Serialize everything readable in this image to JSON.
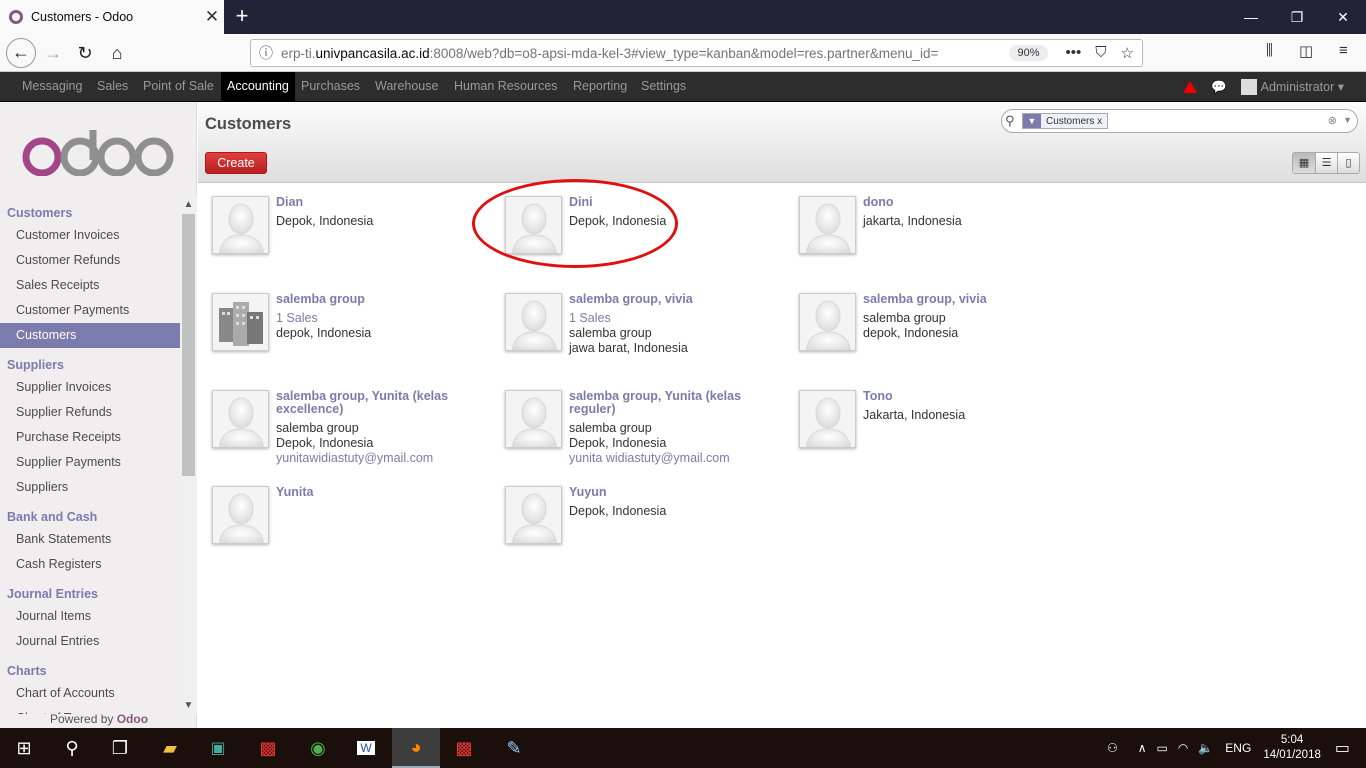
{
  "browser": {
    "tab_title": "Customers - Odoo",
    "url_prefix": "erp-ti.",
    "url_domain": "univpancasila.ac.id",
    "url_rest": ":8008/web?db=o8-apsi-mda-kel-3#view_type=kanban&model=res.partner&menu_id=",
    "zoom": "90%"
  },
  "topmenu": {
    "items": [
      "Messaging",
      "Sales",
      "Point of Sale",
      "Accounting",
      "Purchases",
      "Warehouse",
      "Human Resources",
      "Reporting",
      "Settings"
    ],
    "active": "Accounting",
    "user": "Administrator"
  },
  "sidebar": {
    "logo": "odoo",
    "sections": [
      {
        "title": "Customers",
        "items": [
          "Customer Invoices",
          "Customer Refunds",
          "Sales Receipts",
          "Customer Payments",
          "Customers"
        ]
      },
      {
        "title": "Suppliers",
        "items": [
          "Supplier Invoices",
          "Supplier Refunds",
          "Purchase Receipts",
          "Supplier Payments",
          "Suppliers"
        ]
      },
      {
        "title": "Bank and Cash",
        "items": [
          "Bank Statements",
          "Cash Registers"
        ]
      },
      {
        "title": "Journal Entries",
        "items": [
          "Journal Items",
          "Journal Entries"
        ]
      },
      {
        "title": "Charts",
        "items": [
          "Chart of Accounts",
          "Chart of Taxes"
        ]
      }
    ],
    "active_item": "Customers",
    "powered_by": "Powered by",
    "powered_brand": "Odoo"
  },
  "header": {
    "title": "Customers",
    "create_label": "Create",
    "search_facet": "Customers",
    "facet_close": "x"
  },
  "kanban": [
    {
      "name": "Dian",
      "lines": [
        "Depok, Indonesia"
      ],
      "email": "",
      "company": false
    },
    {
      "name": "Dini",
      "lines": [
        "Depok, Indonesia"
      ],
      "email": "",
      "company": false
    },
    {
      "name": "dono",
      "lines": [
        "jakarta, Indonesia"
      ],
      "email": "",
      "company": false
    },
    {
      "name": "salemba group",
      "sales": "1 Sales",
      "lines": [
        "depok, Indonesia"
      ],
      "email": "",
      "company": true
    },
    {
      "name": "salemba group, vivia",
      "sales": "1 Sales",
      "lines": [
        "salemba group",
        "jawa barat, Indonesia"
      ],
      "email": "",
      "company": false
    },
    {
      "name": "salemba group, vivia",
      "lines": [
        "salemba group",
        "depok, Indonesia"
      ],
      "email": "",
      "company": false
    },
    {
      "name": "salemba group, Yunita (kelas excellence)",
      "lines": [
        "salemba group",
        "Depok, Indonesia"
      ],
      "email": "yunitawidiastuty@ymail.com",
      "company": false
    },
    {
      "name": "salemba group, Yunita (kelas reguler)",
      "lines": [
        "salemba group",
        "Depok, Indonesia"
      ],
      "email": "yunita widiastuty@ymail.com",
      "company": false
    },
    {
      "name": "Tono",
      "lines": [
        "Jakarta, Indonesia"
      ],
      "email": "",
      "company": false
    },
    {
      "name": "Yunita",
      "lines": [],
      "email": "",
      "company": false
    },
    {
      "name": "Yuyun",
      "lines": [
        "Depok, Indonesia"
      ],
      "email": "",
      "company": false
    }
  ],
  "taskbar": {
    "lang": "ENG",
    "time": "5:04",
    "date": "14/01/2018"
  }
}
